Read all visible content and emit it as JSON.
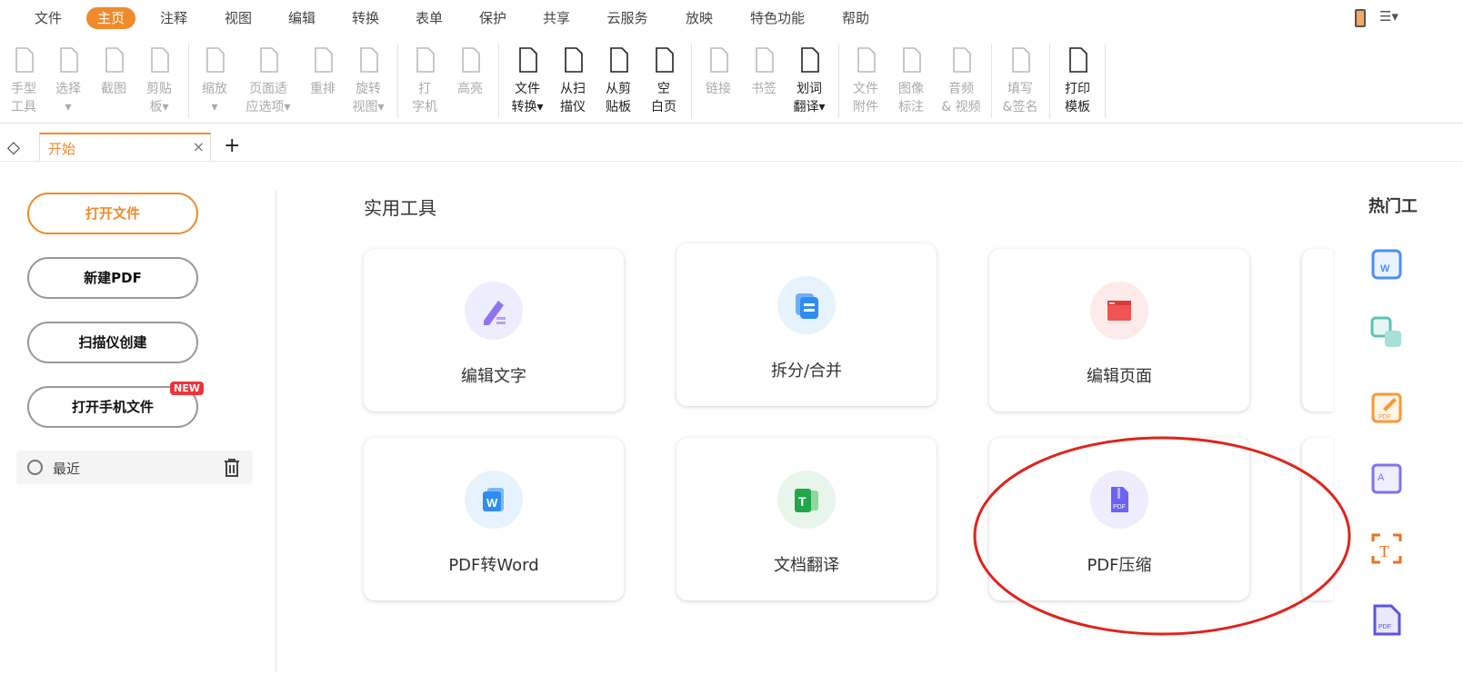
{
  "menu": [
    "文件",
    "主页",
    "注释",
    "视图",
    "编辑",
    "转换",
    "表单",
    "保护",
    "共享",
    "云服务",
    "放映",
    "特色功能",
    "帮助"
  ],
  "toolbar": [
    {
      "l1": "手型",
      "l2": "工具"
    },
    {
      "l1": "选择",
      "l2": "▾"
    },
    {
      "l1": "截图",
      "l2": ""
    },
    {
      "l1": "剪贴",
      "l2": "板▾"
    },
    {
      "l1": "缩放",
      "l2": "▾"
    },
    {
      "l1": "页面适",
      "l2": "应选项▾"
    },
    {
      "l1": "重排",
      "l2": ""
    },
    {
      "l1": "旋转",
      "l2": "视图▾"
    },
    {
      "l1": "打",
      "l2": "字机"
    },
    {
      "l1": "高亮",
      "l2": ""
    },
    {
      "l1": "文件",
      "l2": "转换▾"
    },
    {
      "l1": "从扫",
      "l2": "描仪"
    },
    {
      "l1": "从剪",
      "l2": "贴板"
    },
    {
      "l1": "空",
      "l2": "白页"
    },
    {
      "l1": "链接",
      "l2": ""
    },
    {
      "l1": "书签",
      "l2": ""
    },
    {
      "l1": "划词",
      "l2": "翻译▾"
    },
    {
      "l1": "文件",
      "l2": "附件"
    },
    {
      "l1": "图像",
      "l2": "标注"
    },
    {
      "l1": "音频",
      "l2": "& 视频"
    },
    {
      "l1": "填写",
      "l2": "&签名"
    },
    {
      "l1": "打印",
      "l2": "模板"
    }
  ],
  "tab": {
    "label": "开始",
    "close": "×",
    "add": "+"
  },
  "left": {
    "open": "打开文件",
    "new_pdf": "新建PDF",
    "scan": "扫描仪创建",
    "phone": "打开手机文件",
    "new_badge": "NEW",
    "recent": "最近"
  },
  "main": {
    "title": "实用工具",
    "cards": [
      "编辑文字",
      "拆分/合并",
      "编辑页面",
      "PDF转Word",
      "文档翻译",
      "PDF压缩"
    ]
  },
  "right": {
    "title": "热门工"
  },
  "colors": {
    "accent": "#f08a2c",
    "annotation": "#e0231c"
  }
}
